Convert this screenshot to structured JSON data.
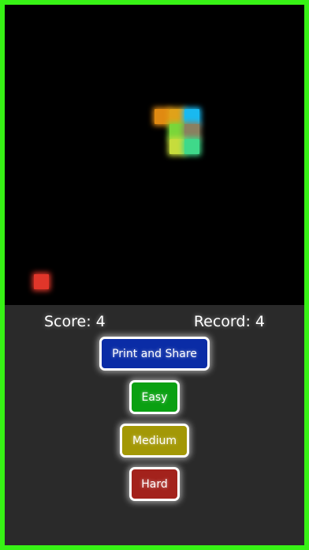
{
  "colors": {
    "border": "#37f215",
    "board": "#000000",
    "panel": "#2a2a2a",
    "print_button": "#0a2ca6",
    "easy_button": "#0aa012",
    "medium_button": "#a39806",
    "hard_button": "#a3221c",
    "food": "#e0362a"
  },
  "snake_segments": [
    {
      "color": "#e08a12"
    },
    {
      "color": "#e0a21a"
    },
    {
      "color": "#19b9f0"
    },
    {
      "color": "#7ad63a"
    },
    {
      "color": "#8b8060"
    },
    {
      "color": "#c6dc3c"
    },
    {
      "color": "#3fd98a"
    }
  ],
  "food": {
    "color": "#e0362a"
  },
  "scorebar": {
    "score": "Score: 4",
    "record": "Record: 4"
  },
  "buttons": {
    "print_share": "Print and Share",
    "easy": "Easy",
    "medium": "Medium",
    "hard": "Hard"
  }
}
